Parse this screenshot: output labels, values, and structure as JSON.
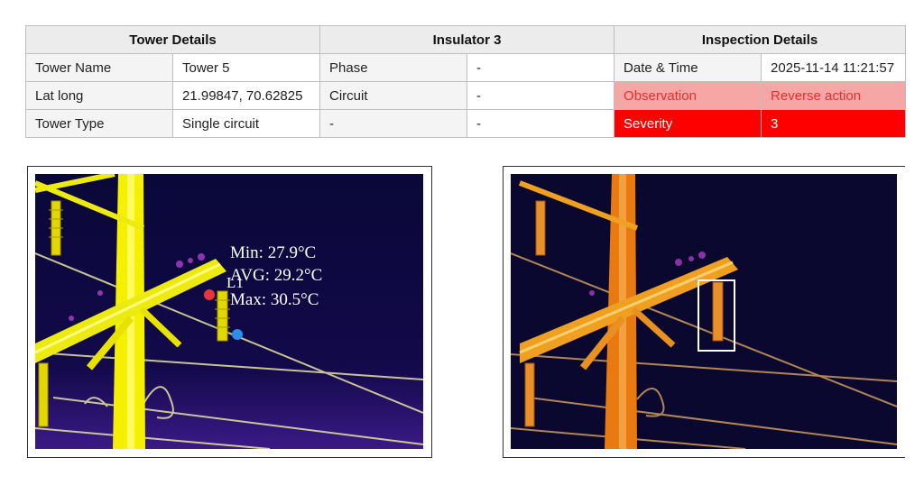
{
  "table": {
    "headers": [
      "Tower Details",
      "Insulator 3",
      "Inspection Details"
    ],
    "rows": [
      [
        "Tower Name",
        "Tower 5",
        "Phase",
        "-",
        "Date & Time",
        "2025-11-14 11:21:57"
      ],
      [
        "Lat long",
        "21.99847, 70.62825",
        "Circuit",
        "-",
        "Observation",
        "Reverse action"
      ],
      [
        "Tower Type",
        "Single circuit",
        "-",
        "-",
        "Severity",
        "3"
      ]
    ],
    "colors": {
      "observation_bg": "#f7a6a6",
      "observation_text": "#e53030",
      "severity_bg": "#ff0000",
      "severity_text": "#ffffff"
    }
  },
  "images": {
    "left": {
      "readings": {
        "min": "Min: 27.9°C",
        "avg": "AVG: 29.2°C",
        "max": "Max: 30.5°C"
      },
      "marker_label": "L1"
    },
    "right": {}
  }
}
